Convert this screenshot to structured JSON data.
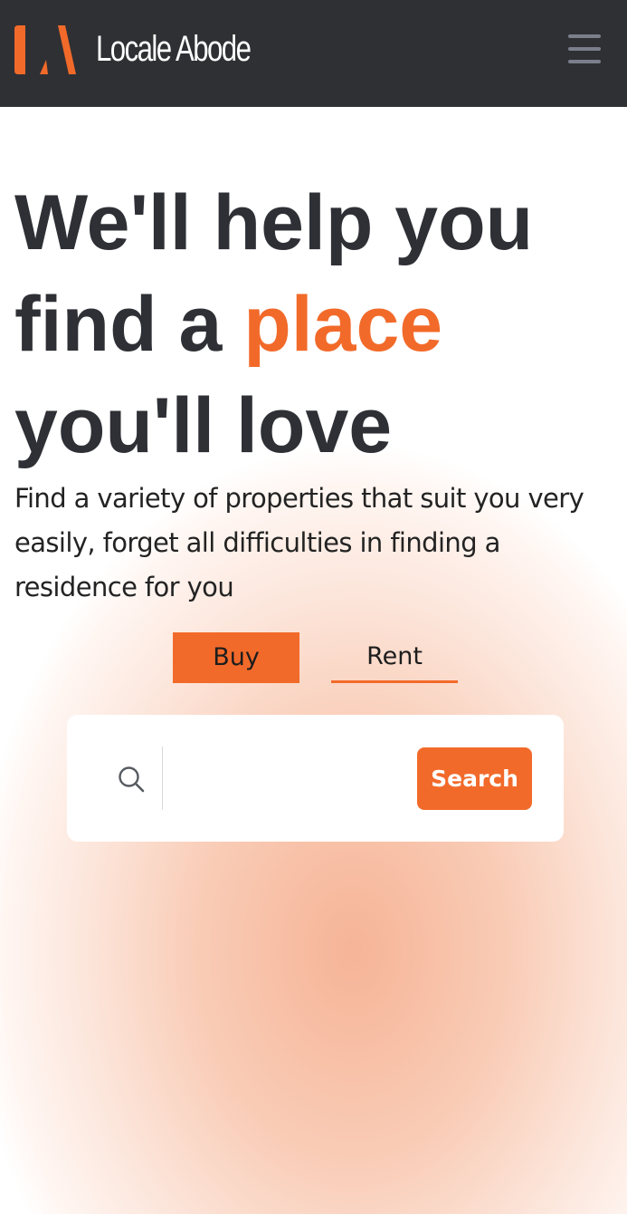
{
  "header": {
    "brand_name": "Locale Abode",
    "logo_icon": "la-logo-icon",
    "menu_icon": "hamburger-menu-icon",
    "background_color": "#2f3034",
    "logo_color": "#f26a2a"
  },
  "hero": {
    "title_line1": "We'll help you",
    "title_line2_prefix": "find a ",
    "title_line2_accent": "place",
    "title_line3": "you'll love",
    "subtitle": "Find a variety of properties that suit you very easily, forget all difficulties in finding a residence for you",
    "accent_color": "#f26a2a",
    "text_color": "#2e3035"
  },
  "tabs": {
    "buy_label": "Buy",
    "rent_label": "Rent",
    "active": "Buy"
  },
  "search": {
    "icon": "search-icon",
    "input_value": "",
    "input_placeholder": "",
    "button_label": "Search"
  }
}
